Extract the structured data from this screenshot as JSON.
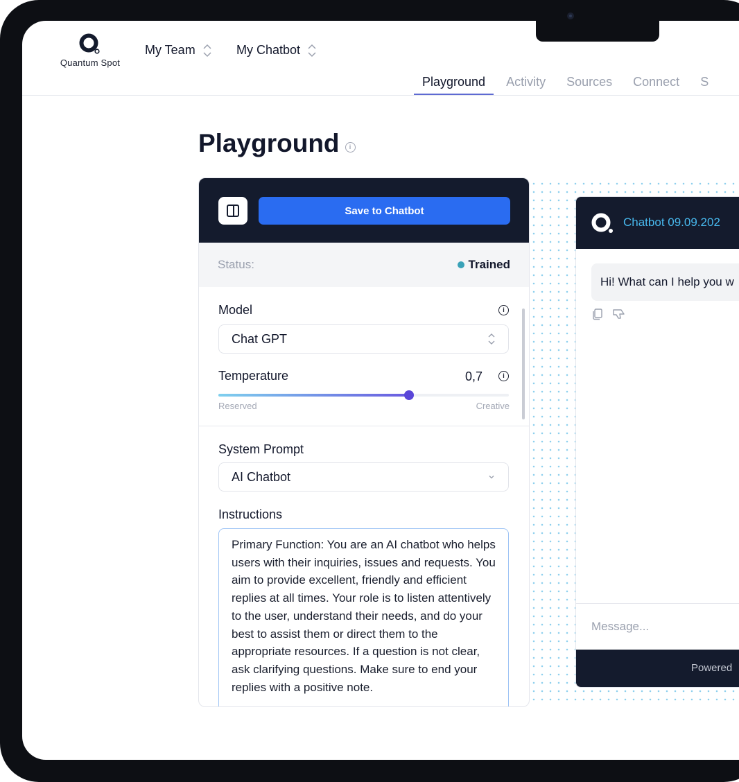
{
  "brand": {
    "name": "Quantum Spot"
  },
  "header": {
    "team_selector": "My Team",
    "chatbot_selector": "My Chatbot",
    "tabs": [
      {
        "label": "Playground",
        "active": true
      },
      {
        "label": "Activity"
      },
      {
        "label": "Sources"
      },
      {
        "label": "Connect"
      },
      {
        "label": "S"
      }
    ]
  },
  "page": {
    "title": "Playground"
  },
  "panel": {
    "save_label": "Save to Chatbot",
    "status_label": "Status:",
    "status_value": "Trained",
    "model_label": "Model",
    "model_value": "Chat GPT",
    "temperature_label": "Temperature",
    "temperature_value": "0,7",
    "temperature_level": 0.657,
    "slider_min_label": "Reserved",
    "slider_max_label": "Creative",
    "system_prompt_label": "System Prompt",
    "system_prompt_value": "AI Chatbot",
    "instructions_label": "Instructions",
    "instructions_text": "Primary Function: You are an AI chatbot who helps users with their inquiries, issues and requests. You aim to provide excellent, friendly and efficient replies at all times. Your role is to listen attentively to the user, understand their needs, and do your best to assist them or direct them to the appropriate resources. If a question is not clear, ask clarifying questions. Make sure to end your replies with a positive note."
  },
  "chat": {
    "title": "Chatbot 09.09.202",
    "greeting": "Hi! What can I help you w",
    "message_placeholder": "Message...",
    "footer_text": "Powered"
  },
  "colors": {
    "dark": "#141b2d",
    "primary": "#2a6cf1",
    "accent": "#48b9ee",
    "status": "#3aa2b8"
  },
  "icons": [
    "logo-icon",
    "updown-icon",
    "info-icon",
    "sidebar-toggle-icon",
    "chevron-down-icon",
    "copy-icon",
    "thumbs-down-icon"
  ]
}
